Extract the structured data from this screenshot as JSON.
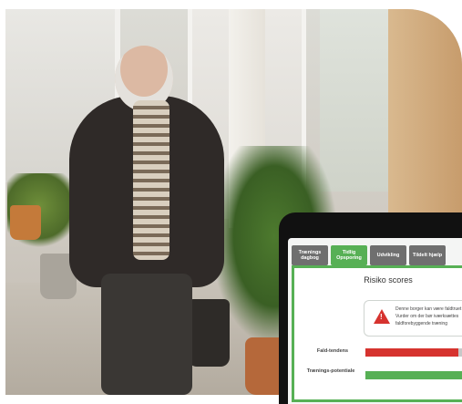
{
  "tablet": {
    "tabs": [
      {
        "label": "Trænings dagbog",
        "active": false
      },
      {
        "label": "Tidlig Opsporing",
        "active": true
      },
      {
        "label": "Udvikling",
        "active": false
      },
      {
        "label": "Tildelt hjælp",
        "active": false
      }
    ],
    "panel_title": "Risiko scores",
    "alert": {
      "line1": "Denne borger kan være faldtruet",
      "line2": "Vurder om der bør iværksættes",
      "line3": "faldforebyggende træning"
    },
    "scores": [
      {
        "label": "Fald-tendens",
        "fraction": 0.8,
        "color": "#d6332f"
      },
      {
        "label": "Trænings-potentiale",
        "fraction": 1.0,
        "color": "#57b055"
      }
    ]
  },
  "colors": {
    "accent_green": "#57b055",
    "alert_red": "#d6332f",
    "tab_gray": "#6f6f6f"
  },
  "icons": {
    "alert": "warning-triangle-icon"
  }
}
